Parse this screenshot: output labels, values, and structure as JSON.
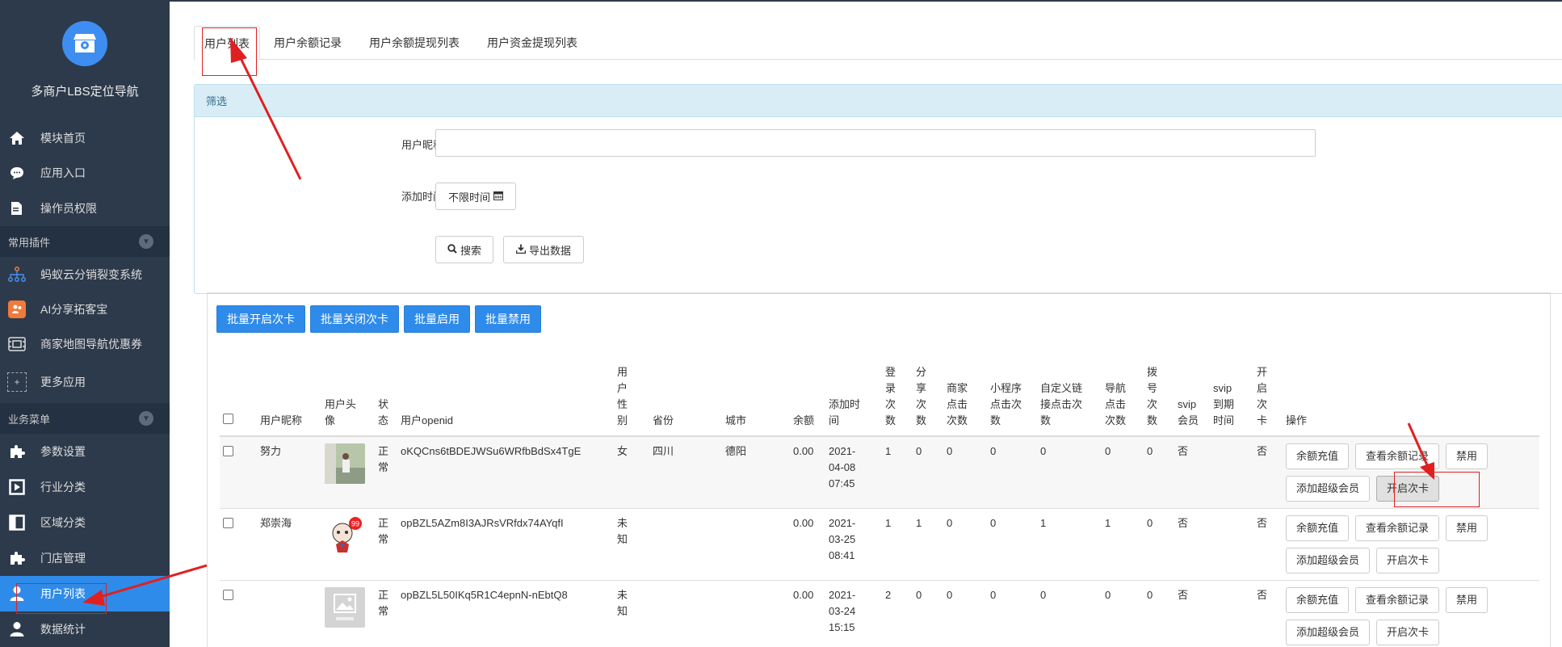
{
  "app": {
    "title": "多商户LBS定位导航"
  },
  "sidebar": {
    "top_items": [
      {
        "label": "模块首页",
        "icon": "home-icon"
      },
      {
        "label": "应用入口",
        "icon": "chat-icon"
      },
      {
        "label": "操作员权限",
        "icon": "edit-doc-icon"
      }
    ],
    "group_plugins": "常用插件",
    "plugins": [
      {
        "label": "蚂蚁云分销裂变系统",
        "icon": "network-icon"
      },
      {
        "label": "AI分享拓客宝",
        "icon": "share-icon"
      },
      {
        "label": "商家地图导航优惠券",
        "icon": "map-coupon-icon"
      },
      {
        "label": "更多应用",
        "icon": "plus-icon"
      }
    ],
    "group_business": "业务菜单",
    "business": [
      {
        "label": "参数设置",
        "icon": "puzzle-icon"
      },
      {
        "label": "行业分类",
        "icon": "play-square-icon"
      },
      {
        "label": "区域分类",
        "icon": "columns-icon"
      },
      {
        "label": "门店管理",
        "icon": "puzzle-icon"
      },
      {
        "label": "用户列表",
        "icon": "user-icon"
      },
      {
        "label": "数据统计",
        "icon": "user-icon"
      }
    ]
  },
  "tabs": [
    "用户列表",
    "用户余额记录",
    "用户余额提现列表",
    "用户资金提现列表"
  ],
  "filter": {
    "title": "筛选",
    "nickname_label": "用户昵称",
    "nickname_value": "",
    "time_label": "添加时间",
    "time_value": "不限时间",
    "search_label": "搜索",
    "export_label": "导出数据"
  },
  "batch": [
    "批量开启次卡",
    "批量关闭次卡",
    "批量启用",
    "批量禁用"
  ],
  "table": {
    "headers": [
      "用户昵称",
      "用户头像",
      "状态",
      "用户openid",
      "用户性别",
      "省份",
      "城市",
      "余额",
      "添加时间",
      "登录次数",
      "分享次数",
      "商家点击次数",
      "小程序点击次数",
      "自定义链接点击次数",
      "导航点击次数",
      "拨号次数",
      "svip会员",
      "svip到期时间",
      "开启次卡",
      "操作"
    ],
    "rows": [
      {
        "nickname": "努力",
        "status": "正常",
        "openid": "oKQCns6tBDEJWSu6WRfbBdSx4TgE",
        "gender": "女",
        "province": "四川",
        "city": "德阳",
        "balance": "0.00",
        "added": "2021-04-08 07:45",
        "login": "1",
        "share": "0",
        "shop_click": "0",
        "mini_click": "0",
        "link_click": "0",
        "nav_click": "0",
        "dial": "0",
        "svip": "否",
        "svip_expire": "",
        "card": "否"
      },
      {
        "nickname": "郑崇海",
        "status": "正常",
        "openid": "opBZL5AZm8I3AJRsVRfdx74AYqfI",
        "gender": "未知",
        "province": "",
        "city": "",
        "balance": "0.00",
        "added": "2021-03-25 08:41",
        "login": "1",
        "share": "1",
        "shop_click": "0",
        "mini_click": "0",
        "link_click": "1",
        "nav_click": "1",
        "dial": "0",
        "svip": "否",
        "svip_expire": "",
        "card": "否"
      },
      {
        "nickname": "",
        "status": "正常",
        "openid": "opBZL5L50IKq5R1C4epnN-nEbtQ8",
        "gender": "未知",
        "province": "",
        "city": "",
        "balance": "0.00",
        "added": "2021-03-24 15:15",
        "login": "2",
        "share": "0",
        "shop_click": "0",
        "mini_click": "0",
        "link_click": "0",
        "nav_click": "0",
        "dial": "0",
        "svip": "否",
        "svip_expire": "",
        "card": "否"
      }
    ],
    "ops": [
      "余额充值",
      "查看余额记录",
      "禁用",
      "添加超级会员",
      "开启次卡"
    ]
  },
  "colors": {
    "sidebar_bg": "#2d3a4b",
    "accent": "#2f8bea",
    "annotation": "#e02020"
  }
}
